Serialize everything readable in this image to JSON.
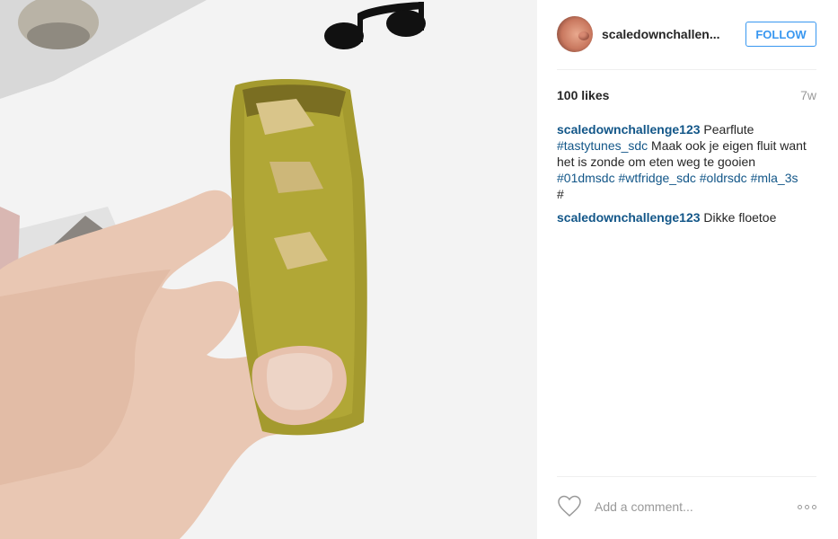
{
  "photo": {
    "alt_icon": "music-notes-icon"
  },
  "header": {
    "username": "scaledownchallen...",
    "follow_label": "FOLLOW"
  },
  "stats": {
    "likes": "100 likes",
    "time": "7w"
  },
  "caption": {
    "user": "scaledownchallenge123",
    "text1": " Pearflute ",
    "tag1": "#tastytunes_sdc",
    "text2": " Maak ook je eigen fluit want het is zonde om eten weg te gooien ",
    "tag2": "#01dmsdc",
    "tag3": "#wtfridge_sdc",
    "tag4": "#oldrsdc",
    "tag5": "#mla_3s",
    "tag6": "#"
  },
  "comment1": {
    "user": "scaledownchallenge123",
    "text": " Dikke floetoe"
  },
  "footer": {
    "comment_placeholder": "Add a comment...",
    "heart_icon": "heart-icon",
    "more_icon": "more-options-icon"
  },
  "colors": {
    "link": "#125688",
    "follow": "#3897f0",
    "muted": "#999999"
  }
}
